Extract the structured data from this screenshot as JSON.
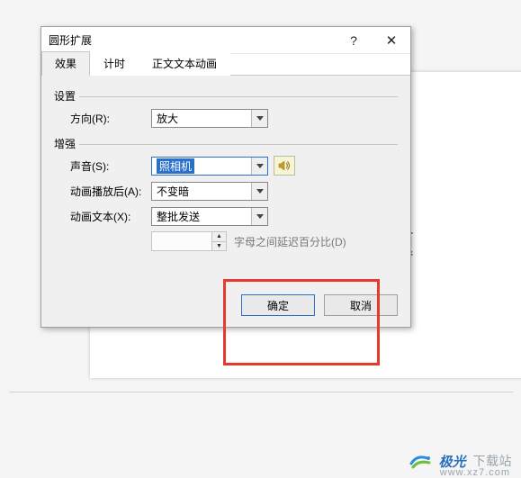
{
  "background": {
    "partial_text": "题"
  },
  "dialog": {
    "title": "圆形扩展",
    "help_symbol": "?",
    "close_symbol": "✕",
    "tabs": [
      {
        "label": "效果"
      },
      {
        "label": "计时"
      },
      {
        "label": "正文文本动画"
      }
    ],
    "groups": {
      "settings": {
        "label": "设置",
        "direction_label": "方向(R):",
        "direction_value": "放大"
      },
      "enhance": {
        "label": "增强",
        "sound_label": "声音(S):",
        "sound_value": "照相机",
        "after_anim_label": "动画播放后(A):",
        "after_anim_value": "不变暗",
        "anim_text_label": "动画文本(X):",
        "anim_text_value": "整批发送",
        "percent_label": "字母之间延迟百分比(D)"
      }
    },
    "buttons": {
      "ok": "确定",
      "cancel": "取消"
    }
  },
  "watermark": {
    "brand": "极光",
    "brand2": "下载站",
    "url": "www.xz7.com"
  }
}
